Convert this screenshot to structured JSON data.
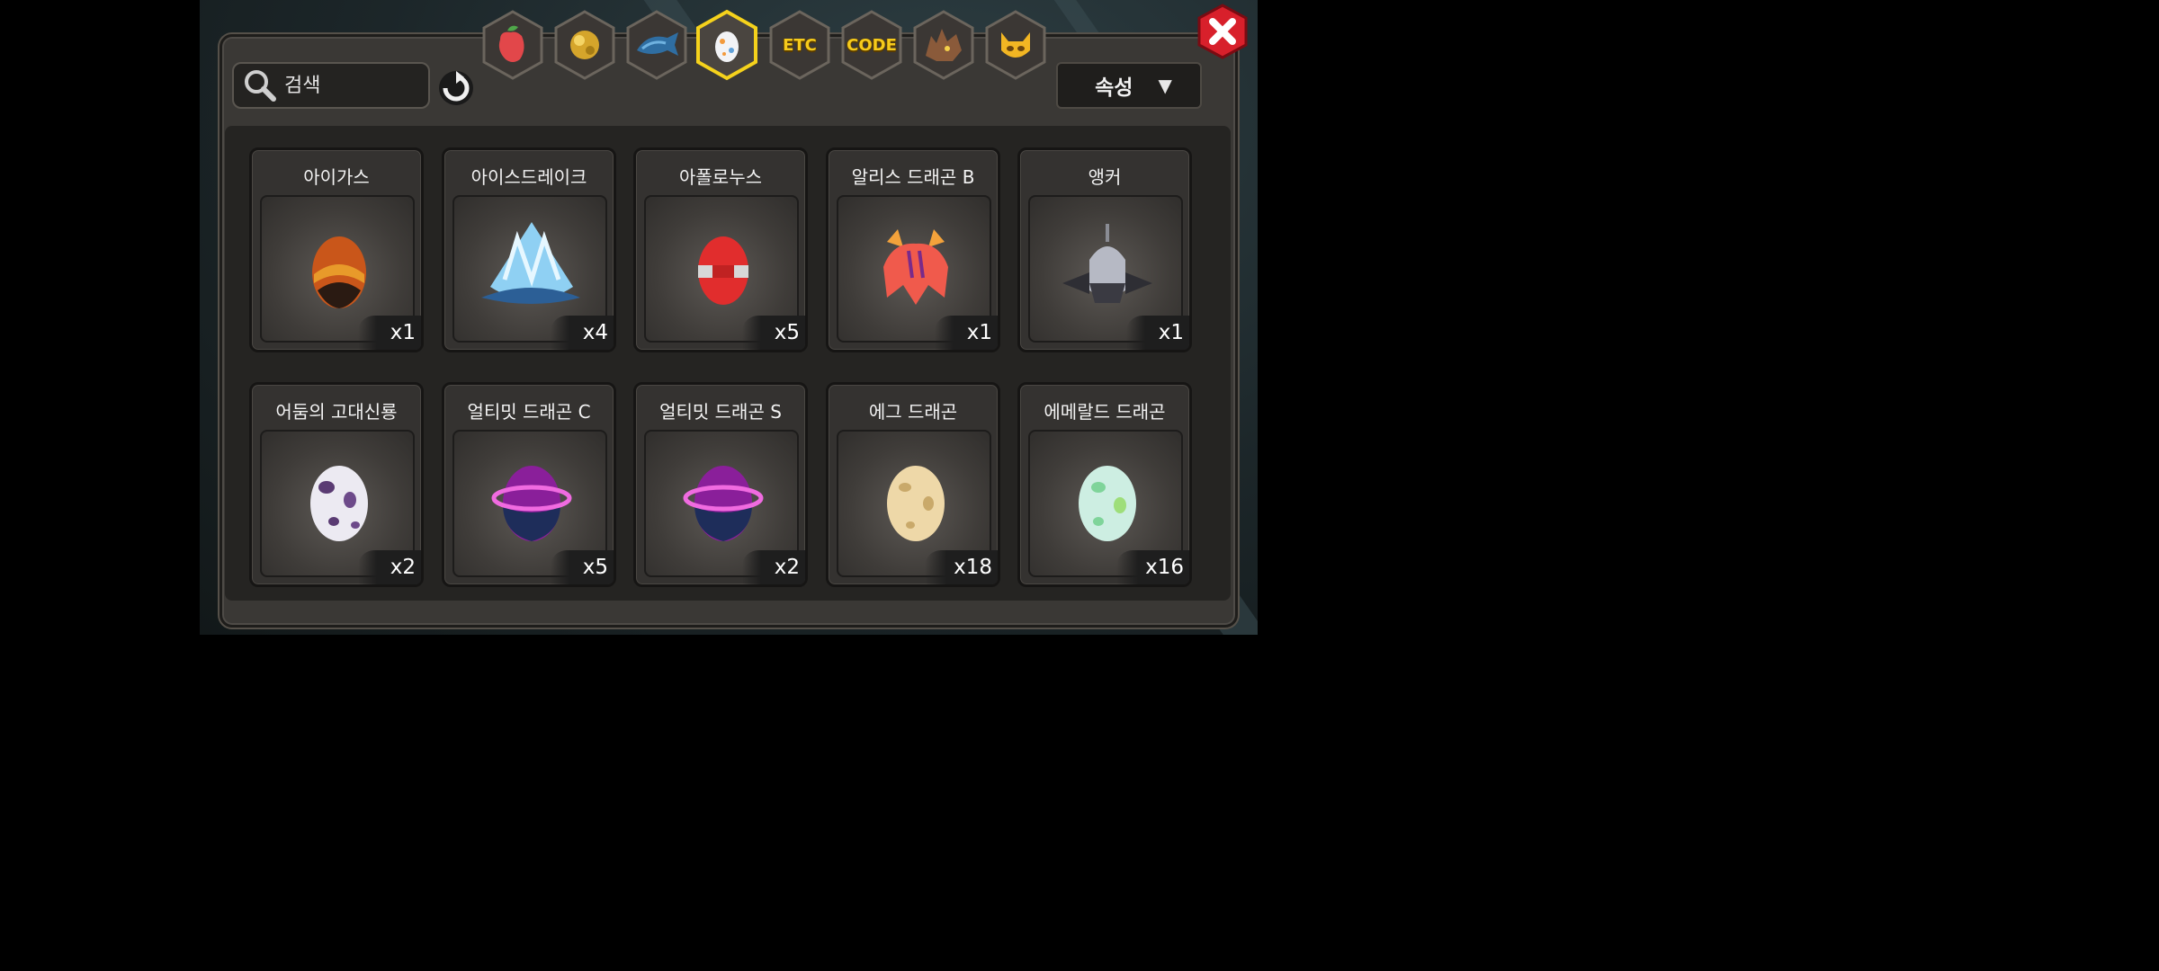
{
  "search": {
    "placeholder": "검색"
  },
  "sort": {
    "label": "속성"
  },
  "tabs": [
    {
      "name": "fruit",
      "icon": "red-fruit-icon"
    },
    {
      "name": "gold",
      "icon": "gold-nugget-icon"
    },
    {
      "name": "fish",
      "icon": "blue-fish-icon"
    },
    {
      "name": "egg",
      "icon": "egg-icon",
      "selected": true
    },
    {
      "name": "etc",
      "label": "ETC"
    },
    {
      "name": "code",
      "label": "CODE"
    },
    {
      "name": "dragon",
      "icon": "dragon-head-icon"
    },
    {
      "name": "face",
      "icon": "horned-face-icon"
    }
  ],
  "items": [
    {
      "name": "아이가스",
      "qty": "x1"
    },
    {
      "name": "아이스드레이크",
      "qty": "x4"
    },
    {
      "name": "아폴로누스",
      "qty": "x5"
    },
    {
      "name": "알리스 드래곤 B",
      "qty": "x1"
    },
    {
      "name": "앵커",
      "qty": "x1"
    },
    {
      "name": "어둠의 고대신룡",
      "qty": "x2"
    },
    {
      "name": "얼티밋 드래곤 C",
      "qty": "x5"
    },
    {
      "name": "얼티밋 드래곤 S",
      "qty": "x2"
    },
    {
      "name": "에그 드래곤",
      "qty": "x18"
    },
    {
      "name": "에메랄드 드래곤",
      "qty": "x16"
    }
  ],
  "colors": {
    "accent": "#f6cb1c",
    "close": "#d8202b",
    "panel": "#3a3835"
  }
}
